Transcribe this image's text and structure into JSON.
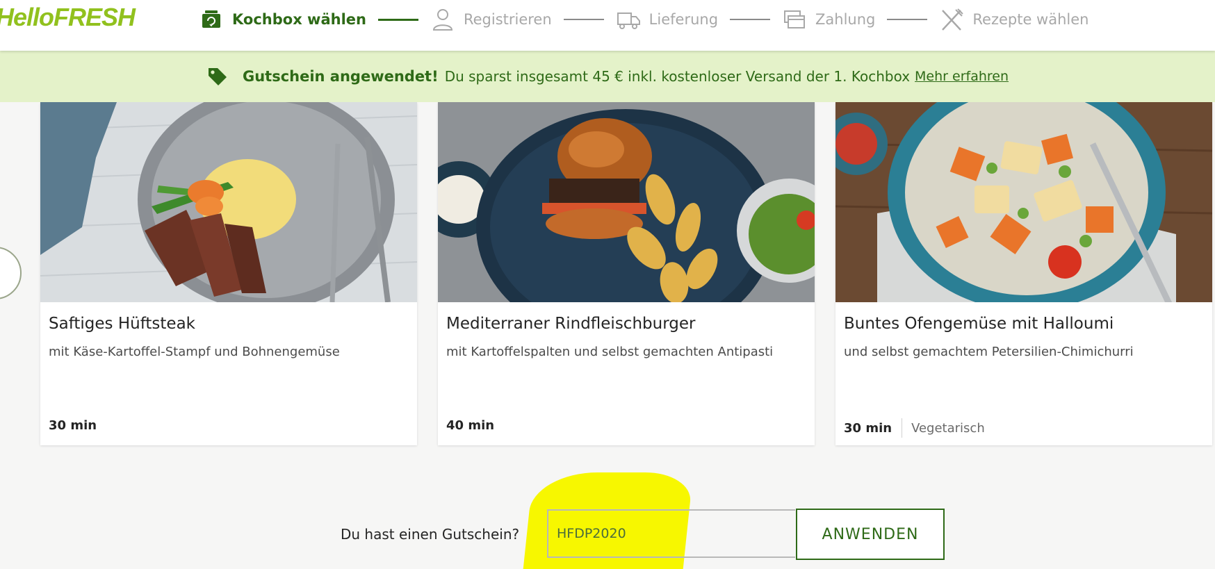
{
  "header": {
    "logo": "HelloFRESH",
    "steps": [
      {
        "label": "Kochbox wählen",
        "icon": "box-icon",
        "active": true
      },
      {
        "label": "Registrieren",
        "icon": "user-icon",
        "active": false
      },
      {
        "label": "Lieferung",
        "icon": "truck-icon",
        "active": false
      },
      {
        "label": "Zahlung",
        "icon": "payment-card-icon",
        "active": false
      },
      {
        "label": "Rezepte wählen",
        "icon": "fork-knife-icon",
        "active": false
      }
    ]
  },
  "banner": {
    "icon": "tag-icon",
    "strong": "Gutschein angewendet!",
    "text": "Du sparst insgesamt 45 € inkl. kostenloser Versand der 1. Kochbox",
    "link": "Mehr erfahren"
  },
  "recipes": [
    {
      "title": "Saftiges Hüftsteak",
      "subtitle": "mit Käse-Kartoffel-Stampf und Bohnengemüse",
      "time": "30 min",
      "tag": ""
    },
    {
      "title": "Mediterraner Rindfleischburger",
      "subtitle": "mit Kartoffelspalten und selbst gemachten Antipasti",
      "time": "40 min",
      "tag": ""
    },
    {
      "title": "Buntes Ofengemüse mit Halloumi",
      "subtitle": "und selbst gemachtem Petersilien-Chimichurri",
      "time": "30 min",
      "tag": "Vegetarisch"
    }
  ],
  "voucher": {
    "label": "Du hast einen Gutschein?",
    "value": "HFDP2020",
    "button": "ANWENDEN"
  },
  "colors": {
    "brand_green": "#91c11e",
    "dark_green": "#2e6a17",
    "banner_bg": "#e4f2c9",
    "highlight": "#f7f700"
  }
}
